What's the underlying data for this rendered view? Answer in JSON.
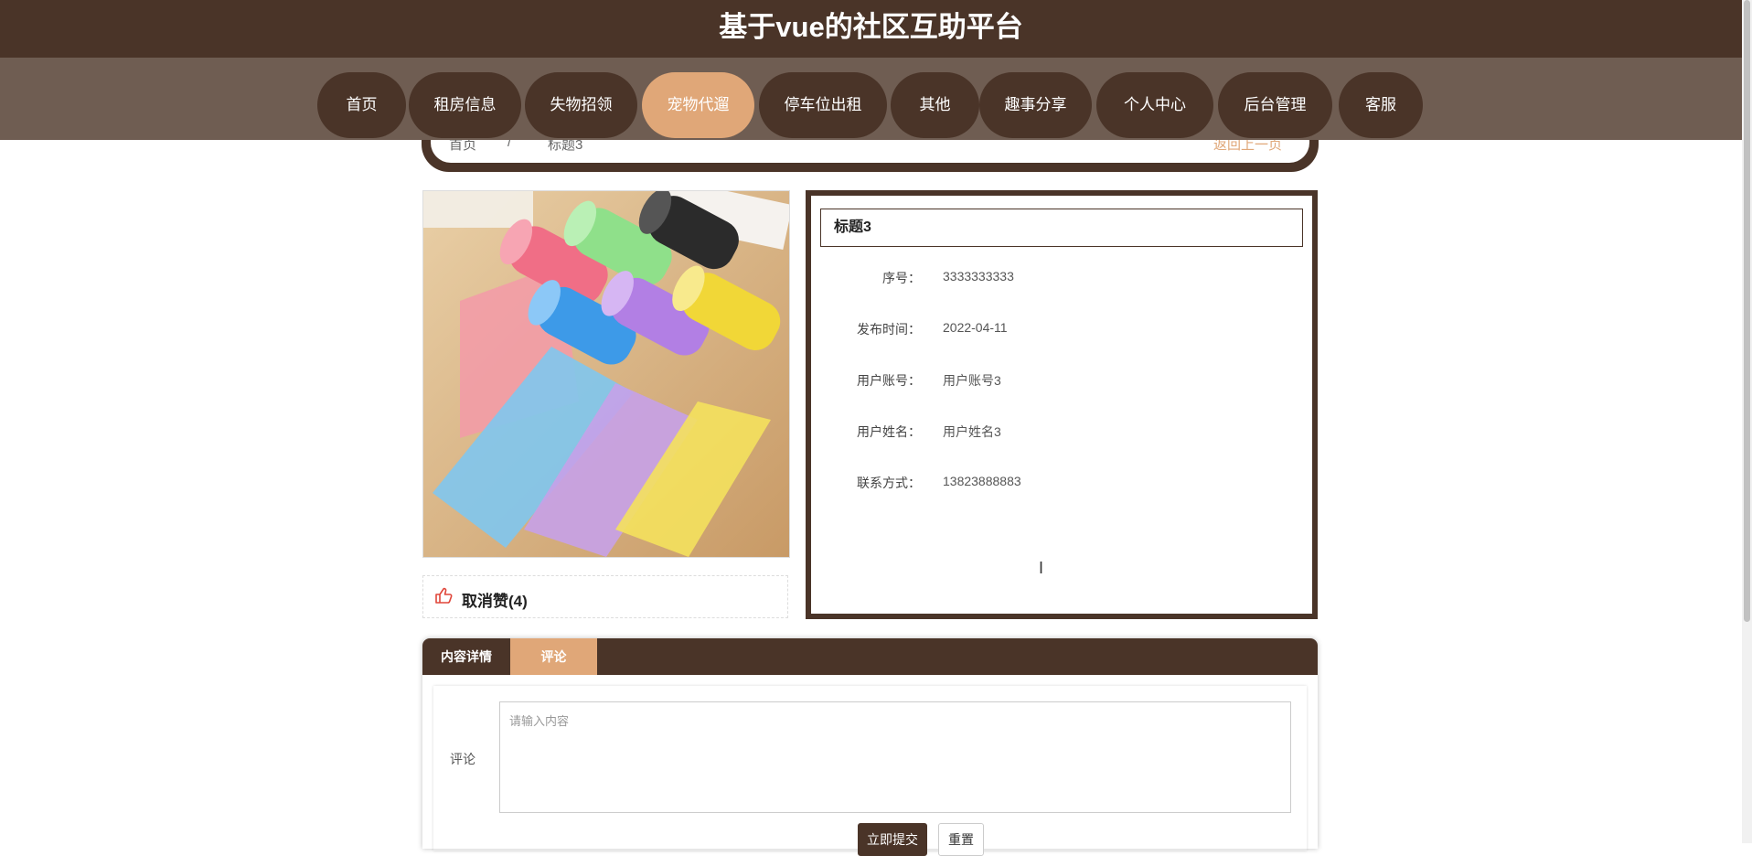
{
  "header": {
    "title": "基于vue的社区互助平台"
  },
  "nav": {
    "items": [
      {
        "label": "首页"
      },
      {
        "label": "租房信息"
      },
      {
        "label": "失物招领"
      },
      {
        "label": "宠物代遛"
      },
      {
        "label": "停车位出租"
      },
      {
        "label": "其他"
      },
      {
        "label": "趣事分享"
      },
      {
        "label": "个人中心"
      },
      {
        "label": "后台管理"
      },
      {
        "label": "客服"
      }
    ],
    "active": "宠物代遛"
  },
  "breadcrumb": {
    "home": "首页",
    "separator": "/",
    "current": "标题3",
    "back": "返回上一页"
  },
  "like": {
    "label": "取消赞(4)"
  },
  "detail": {
    "title": "标题3",
    "fields": [
      {
        "label": "序号：",
        "value": "3333333333"
      },
      {
        "label": "发布时间：",
        "value": "2022-04-11"
      },
      {
        "label": "用户账号：",
        "value": "用户账号3"
      },
      {
        "label": "用户姓名：",
        "value": "用户姓名3"
      },
      {
        "label": "联系方式：",
        "value": "13823888883"
      }
    ]
  },
  "tabs": [
    {
      "label": "内容详情"
    },
    {
      "label": "评论"
    }
  ],
  "comment": {
    "label": "评论",
    "placeholder": "请输入内容",
    "submit": "立即提交",
    "reset": "重置"
  },
  "colors": {
    "primary": "#4a3428",
    "accent": "#e0a778",
    "nav_bg": "#6f5d52"
  }
}
